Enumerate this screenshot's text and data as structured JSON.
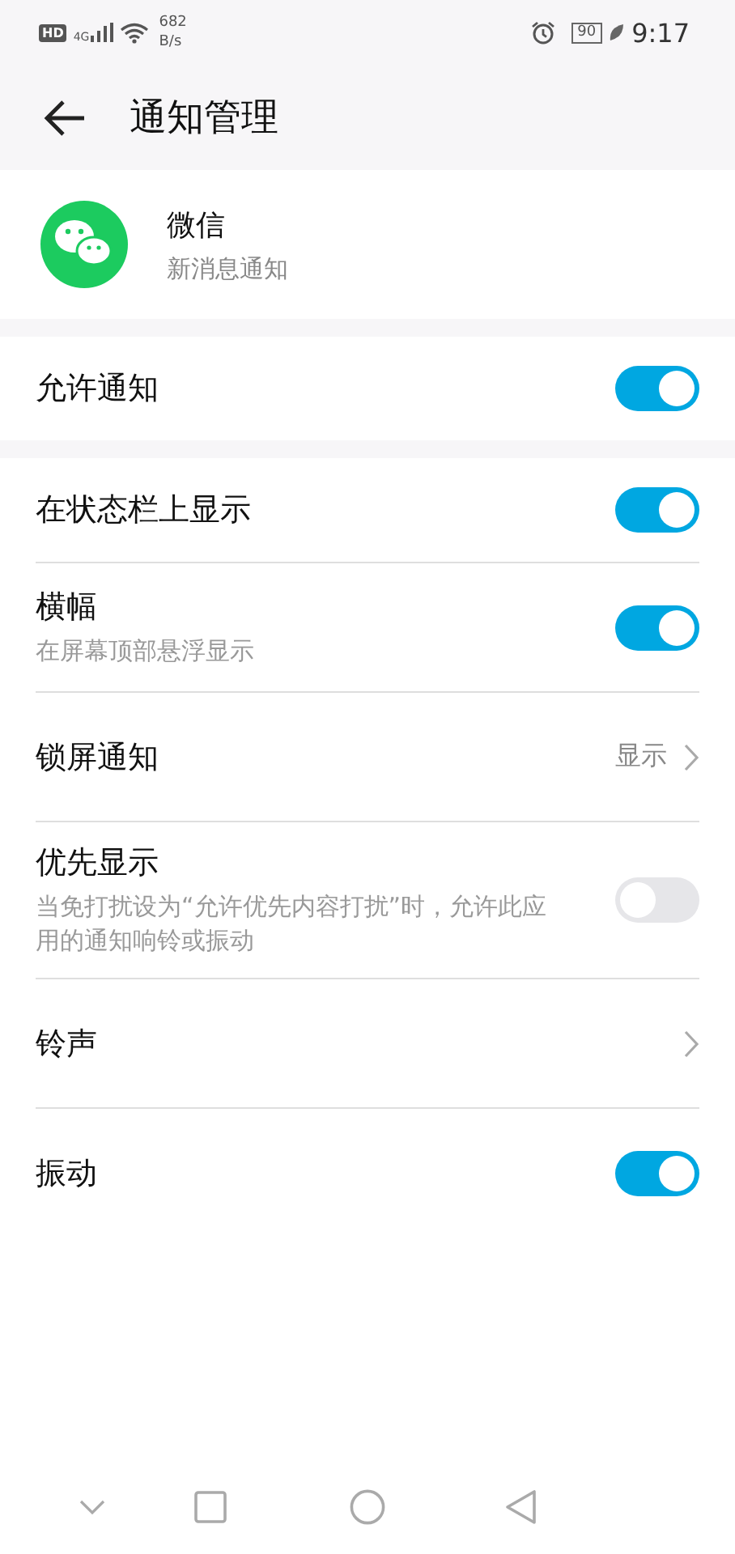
{
  "status_bar": {
    "hd": "HD",
    "network": "4G",
    "speed": "682",
    "speed_unit": "B/s",
    "battery": "90",
    "time": "9:17"
  },
  "header": {
    "title": "通知管理"
  },
  "app": {
    "name": "微信",
    "subtitle": "新消息通知"
  },
  "sections": [
    {
      "items": [
        {
          "kind": "toggle",
          "label": "允许通知",
          "on": true
        }
      ]
    },
    {
      "items": [
        {
          "kind": "toggle",
          "label": "在状态栏上显示",
          "on": true
        },
        {
          "kind": "toggle",
          "label": "横幅",
          "subtitle": "在屏幕顶部悬浮显示",
          "on": true
        },
        {
          "kind": "link",
          "label": "锁屏通知",
          "value": "显示"
        },
        {
          "kind": "toggle",
          "label": "优先显示",
          "subtitle": "当免打扰设为“允许优先内容打扰”时，允许此应用的通知响铃或振动",
          "on": false
        },
        {
          "kind": "link",
          "label": "铃声"
        },
        {
          "kind": "toggle",
          "label": "振动",
          "on": true
        }
      ]
    }
  ]
}
